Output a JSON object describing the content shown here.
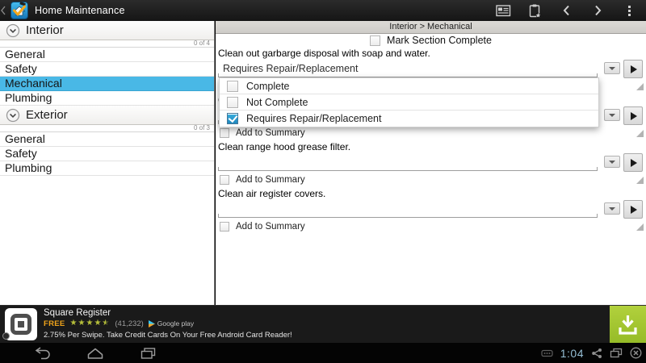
{
  "topbar": {
    "title": "Home Maintenance"
  },
  "sidebar": {
    "sections": [
      {
        "label": "Interior",
        "count": "0 of 4",
        "items": [
          {
            "label": "General",
            "selected": false
          },
          {
            "label": "Safety",
            "selected": false
          },
          {
            "label": "Mechanical",
            "selected": true
          },
          {
            "label": "Plumbing",
            "selected": false
          }
        ]
      },
      {
        "label": "Exterior",
        "count": "0 of 3",
        "items": [
          {
            "label": "General",
            "selected": false
          },
          {
            "label": "Safety",
            "selected": false
          },
          {
            "label": "Plumbing",
            "selected": false
          }
        ]
      }
    ]
  },
  "main": {
    "breadcrumb": "Interior > Mechanical",
    "mark_section_label": "Mark Section Complete",
    "add_to_summary_label": "Add to Summary",
    "tasks": [
      {
        "text": "Clean out garbarge disposal with soap and water.",
        "status": "Requires Repair/Replacement"
      },
      {
        "text": "C",
        "status": ""
      },
      {
        "text": "Clean range hood grease filter.",
        "status": ""
      },
      {
        "text": "Clean air register covers.",
        "status": ""
      }
    ],
    "status_popup": {
      "options": [
        {
          "label": "Complete",
          "checked": false
        },
        {
          "label": "Not Complete",
          "checked": false
        },
        {
          "label": "Requires Repair/Replacement",
          "checked": true
        }
      ]
    }
  },
  "ad": {
    "app_name": "Square Register",
    "price": "FREE",
    "stars": 4.5,
    "rating_count": "(41,232)",
    "store": "Google play",
    "tagline": "2.75% Per Swipe. Take Credit Cards On Your Free Android Card Reader!"
  },
  "statusbar": {
    "time": "1:04"
  },
  "icons": {
    "star": "★"
  },
  "colors": {
    "selection_blue": "#49b8e6",
    "checkbox_blue": "#2e9fd4",
    "download_green": "#a2c62f",
    "free_orange": "#f0a41a",
    "star_green": "#b6bf3a",
    "clock_blue": "#94bed4"
  }
}
